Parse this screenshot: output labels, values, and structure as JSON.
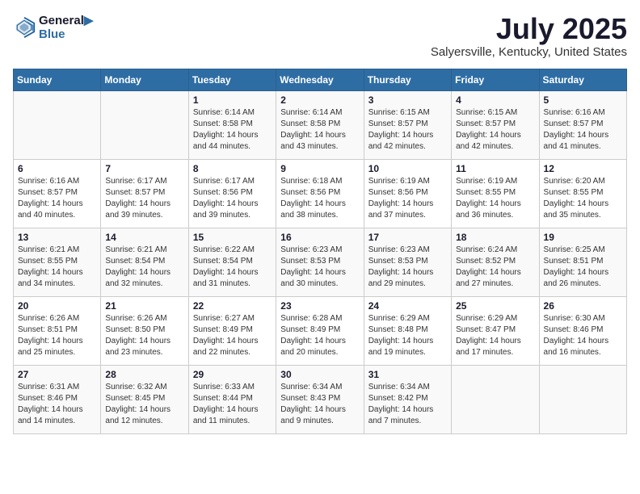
{
  "header": {
    "logo_line1": "General",
    "logo_line2": "Blue",
    "month": "July 2025",
    "location": "Salyersville, Kentucky, United States"
  },
  "weekdays": [
    "Sunday",
    "Monday",
    "Tuesday",
    "Wednesday",
    "Thursday",
    "Friday",
    "Saturday"
  ],
  "weeks": [
    [
      {
        "day": "",
        "info": ""
      },
      {
        "day": "",
        "info": ""
      },
      {
        "day": "1",
        "info": "Sunrise: 6:14 AM\nSunset: 8:58 PM\nDaylight: 14 hours\nand 44 minutes."
      },
      {
        "day": "2",
        "info": "Sunrise: 6:14 AM\nSunset: 8:58 PM\nDaylight: 14 hours\nand 43 minutes."
      },
      {
        "day": "3",
        "info": "Sunrise: 6:15 AM\nSunset: 8:57 PM\nDaylight: 14 hours\nand 42 minutes."
      },
      {
        "day": "4",
        "info": "Sunrise: 6:15 AM\nSunset: 8:57 PM\nDaylight: 14 hours\nand 42 minutes."
      },
      {
        "day": "5",
        "info": "Sunrise: 6:16 AM\nSunset: 8:57 PM\nDaylight: 14 hours\nand 41 minutes."
      }
    ],
    [
      {
        "day": "6",
        "info": "Sunrise: 6:16 AM\nSunset: 8:57 PM\nDaylight: 14 hours\nand 40 minutes."
      },
      {
        "day": "7",
        "info": "Sunrise: 6:17 AM\nSunset: 8:57 PM\nDaylight: 14 hours\nand 39 minutes."
      },
      {
        "day": "8",
        "info": "Sunrise: 6:17 AM\nSunset: 8:56 PM\nDaylight: 14 hours\nand 39 minutes."
      },
      {
        "day": "9",
        "info": "Sunrise: 6:18 AM\nSunset: 8:56 PM\nDaylight: 14 hours\nand 38 minutes."
      },
      {
        "day": "10",
        "info": "Sunrise: 6:19 AM\nSunset: 8:56 PM\nDaylight: 14 hours\nand 37 minutes."
      },
      {
        "day": "11",
        "info": "Sunrise: 6:19 AM\nSunset: 8:55 PM\nDaylight: 14 hours\nand 36 minutes."
      },
      {
        "day": "12",
        "info": "Sunrise: 6:20 AM\nSunset: 8:55 PM\nDaylight: 14 hours\nand 35 minutes."
      }
    ],
    [
      {
        "day": "13",
        "info": "Sunrise: 6:21 AM\nSunset: 8:55 PM\nDaylight: 14 hours\nand 34 minutes."
      },
      {
        "day": "14",
        "info": "Sunrise: 6:21 AM\nSunset: 8:54 PM\nDaylight: 14 hours\nand 32 minutes."
      },
      {
        "day": "15",
        "info": "Sunrise: 6:22 AM\nSunset: 8:54 PM\nDaylight: 14 hours\nand 31 minutes."
      },
      {
        "day": "16",
        "info": "Sunrise: 6:23 AM\nSunset: 8:53 PM\nDaylight: 14 hours\nand 30 minutes."
      },
      {
        "day": "17",
        "info": "Sunrise: 6:23 AM\nSunset: 8:53 PM\nDaylight: 14 hours\nand 29 minutes."
      },
      {
        "day": "18",
        "info": "Sunrise: 6:24 AM\nSunset: 8:52 PM\nDaylight: 14 hours\nand 27 minutes."
      },
      {
        "day": "19",
        "info": "Sunrise: 6:25 AM\nSunset: 8:51 PM\nDaylight: 14 hours\nand 26 minutes."
      }
    ],
    [
      {
        "day": "20",
        "info": "Sunrise: 6:26 AM\nSunset: 8:51 PM\nDaylight: 14 hours\nand 25 minutes."
      },
      {
        "day": "21",
        "info": "Sunrise: 6:26 AM\nSunset: 8:50 PM\nDaylight: 14 hours\nand 23 minutes."
      },
      {
        "day": "22",
        "info": "Sunrise: 6:27 AM\nSunset: 8:49 PM\nDaylight: 14 hours\nand 22 minutes."
      },
      {
        "day": "23",
        "info": "Sunrise: 6:28 AM\nSunset: 8:49 PM\nDaylight: 14 hours\nand 20 minutes."
      },
      {
        "day": "24",
        "info": "Sunrise: 6:29 AM\nSunset: 8:48 PM\nDaylight: 14 hours\nand 19 minutes."
      },
      {
        "day": "25",
        "info": "Sunrise: 6:29 AM\nSunset: 8:47 PM\nDaylight: 14 hours\nand 17 minutes."
      },
      {
        "day": "26",
        "info": "Sunrise: 6:30 AM\nSunset: 8:46 PM\nDaylight: 14 hours\nand 16 minutes."
      }
    ],
    [
      {
        "day": "27",
        "info": "Sunrise: 6:31 AM\nSunset: 8:46 PM\nDaylight: 14 hours\nand 14 minutes."
      },
      {
        "day": "28",
        "info": "Sunrise: 6:32 AM\nSunset: 8:45 PM\nDaylight: 14 hours\nand 12 minutes."
      },
      {
        "day": "29",
        "info": "Sunrise: 6:33 AM\nSunset: 8:44 PM\nDaylight: 14 hours\nand 11 minutes."
      },
      {
        "day": "30",
        "info": "Sunrise: 6:34 AM\nSunset: 8:43 PM\nDaylight: 14 hours\nand 9 minutes."
      },
      {
        "day": "31",
        "info": "Sunrise: 6:34 AM\nSunset: 8:42 PM\nDaylight: 14 hours\nand 7 minutes."
      },
      {
        "day": "",
        "info": ""
      },
      {
        "day": "",
        "info": ""
      }
    ]
  ]
}
